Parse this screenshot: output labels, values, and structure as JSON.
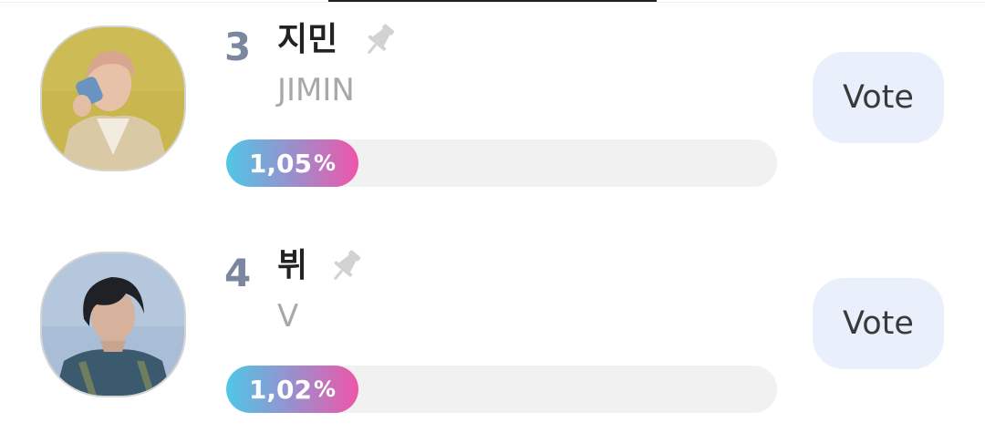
{
  "ranking": {
    "entries": [
      {
        "rank": "3",
        "name_kr": "지민",
        "name_en": "JIMIN",
        "percent_value": "1,05",
        "percent_sign": "%",
        "vote_label": "Vote",
        "fill_fraction": 0.24,
        "pin_icon": "pin-icon",
        "avatar_icon": "avatar-photo"
      },
      {
        "rank": "4",
        "name_kr": "뷔",
        "name_en": "V",
        "percent_value": "1,02",
        "percent_sign": "%",
        "vote_label": "Vote",
        "fill_fraction": 0.24,
        "pin_icon": "pin-icon",
        "avatar_icon": "avatar-photo"
      }
    ]
  },
  "colors": {
    "rank": "#7b879f",
    "bar_start": "#4fc7e6",
    "bar_end": "#ef55a8",
    "vote_bg": "#eaf0fb",
    "track": "#f1f1f1"
  }
}
